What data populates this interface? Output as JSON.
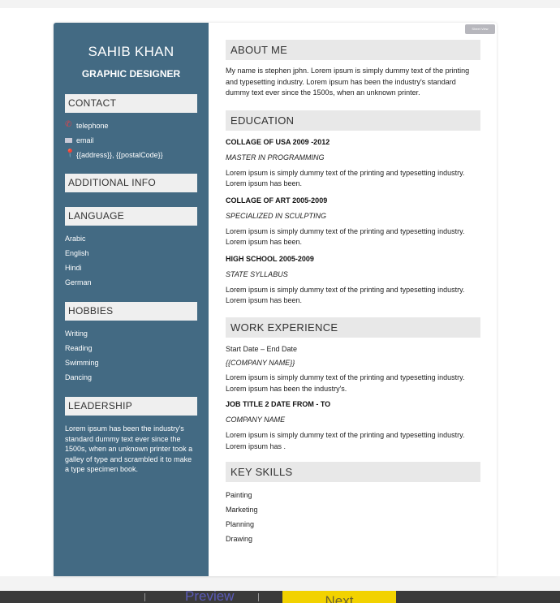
{
  "sheet_view_label": "Sheet View",
  "sidebar": {
    "name": "SAHIB KHAN",
    "role": "GRAPHIC DESIGNER",
    "contact": {
      "heading": "CONTACT",
      "items": [
        "telephone",
        "email",
        "{{address}}, {{postalCode}}"
      ]
    },
    "additional": {
      "heading": "ADDITIONAL INFO"
    },
    "language": {
      "heading": "LANGUAGE",
      "items": [
        "Arabic",
        "English",
        "Hindi",
        "German"
      ]
    },
    "hobbies": {
      "heading": "HOBBIES",
      "items": [
        "Writing",
        "Reading",
        "Swimming",
        "Dancing"
      ]
    },
    "leadership": {
      "heading": "LEADERSHIP",
      "text": "Lorem ipsum has been the industry's standard dummy text ever since the 1500s, when an unknown printer took a galley of type and scrambled it to make a type specimen book."
    }
  },
  "main": {
    "about": {
      "heading": "ABOUT ME",
      "text": "My name is stephen jphn. Lorem ipsum is simply dummy text of the printing and typesetting industry. Lorem ipsum has been the industry's standard dummy text ever since the 1500s, when an unknown printer."
    },
    "education": {
      "heading": "EDUCATION",
      "entries": [
        {
          "title": "COLLAGE OF USA 2009 -2012",
          "subtitle": "MASTER IN PROGRAMMING",
          "text": "Lorem ipsum is simply dummy text of the printing and typesetting industry. Lorem ipsum has been."
        },
        {
          "title": "COLLAGE OF ART 2005-2009",
          "subtitle": "SPECIALIZED IN SCULPTING",
          "text": "Lorem ipsum is simply dummy text of the printing and typesetting industry. Lorem ipsum has been."
        },
        {
          "title": "HIGH SCHOOL 2005-2009",
          "subtitle": "STATE SYLLABUS",
          "text": "Lorem ipsum is simply dummy text of the printing and typesetting industry. Lorem ipsum has been."
        }
      ]
    },
    "work": {
      "heading": "WORK EXPERIENCE",
      "entry1": {
        "dates": "Start Date – End Date",
        "company": "{{COMPANY NAME}}",
        "text": "Lorem ipsum is simply dummy text of the printing and typesetting industry. Lorem ipsum has been the industry's."
      },
      "entry2": {
        "title": "JOB TITLE 2 DATE FROM - TO",
        "company": "COMPANY NAME",
        "text": "Lorem ipsum is simply dummy text of the printing and typesetting industry. Lorem ipsum has ."
      }
    },
    "skills": {
      "heading": "KEY SKILLS",
      "items": [
        "Painting",
        "Marketing",
        "Planning",
        "Drawing"
      ]
    }
  },
  "footer": {
    "preview_label": "Preview",
    "next_label": "Next",
    "next_color": "#f2d200"
  }
}
